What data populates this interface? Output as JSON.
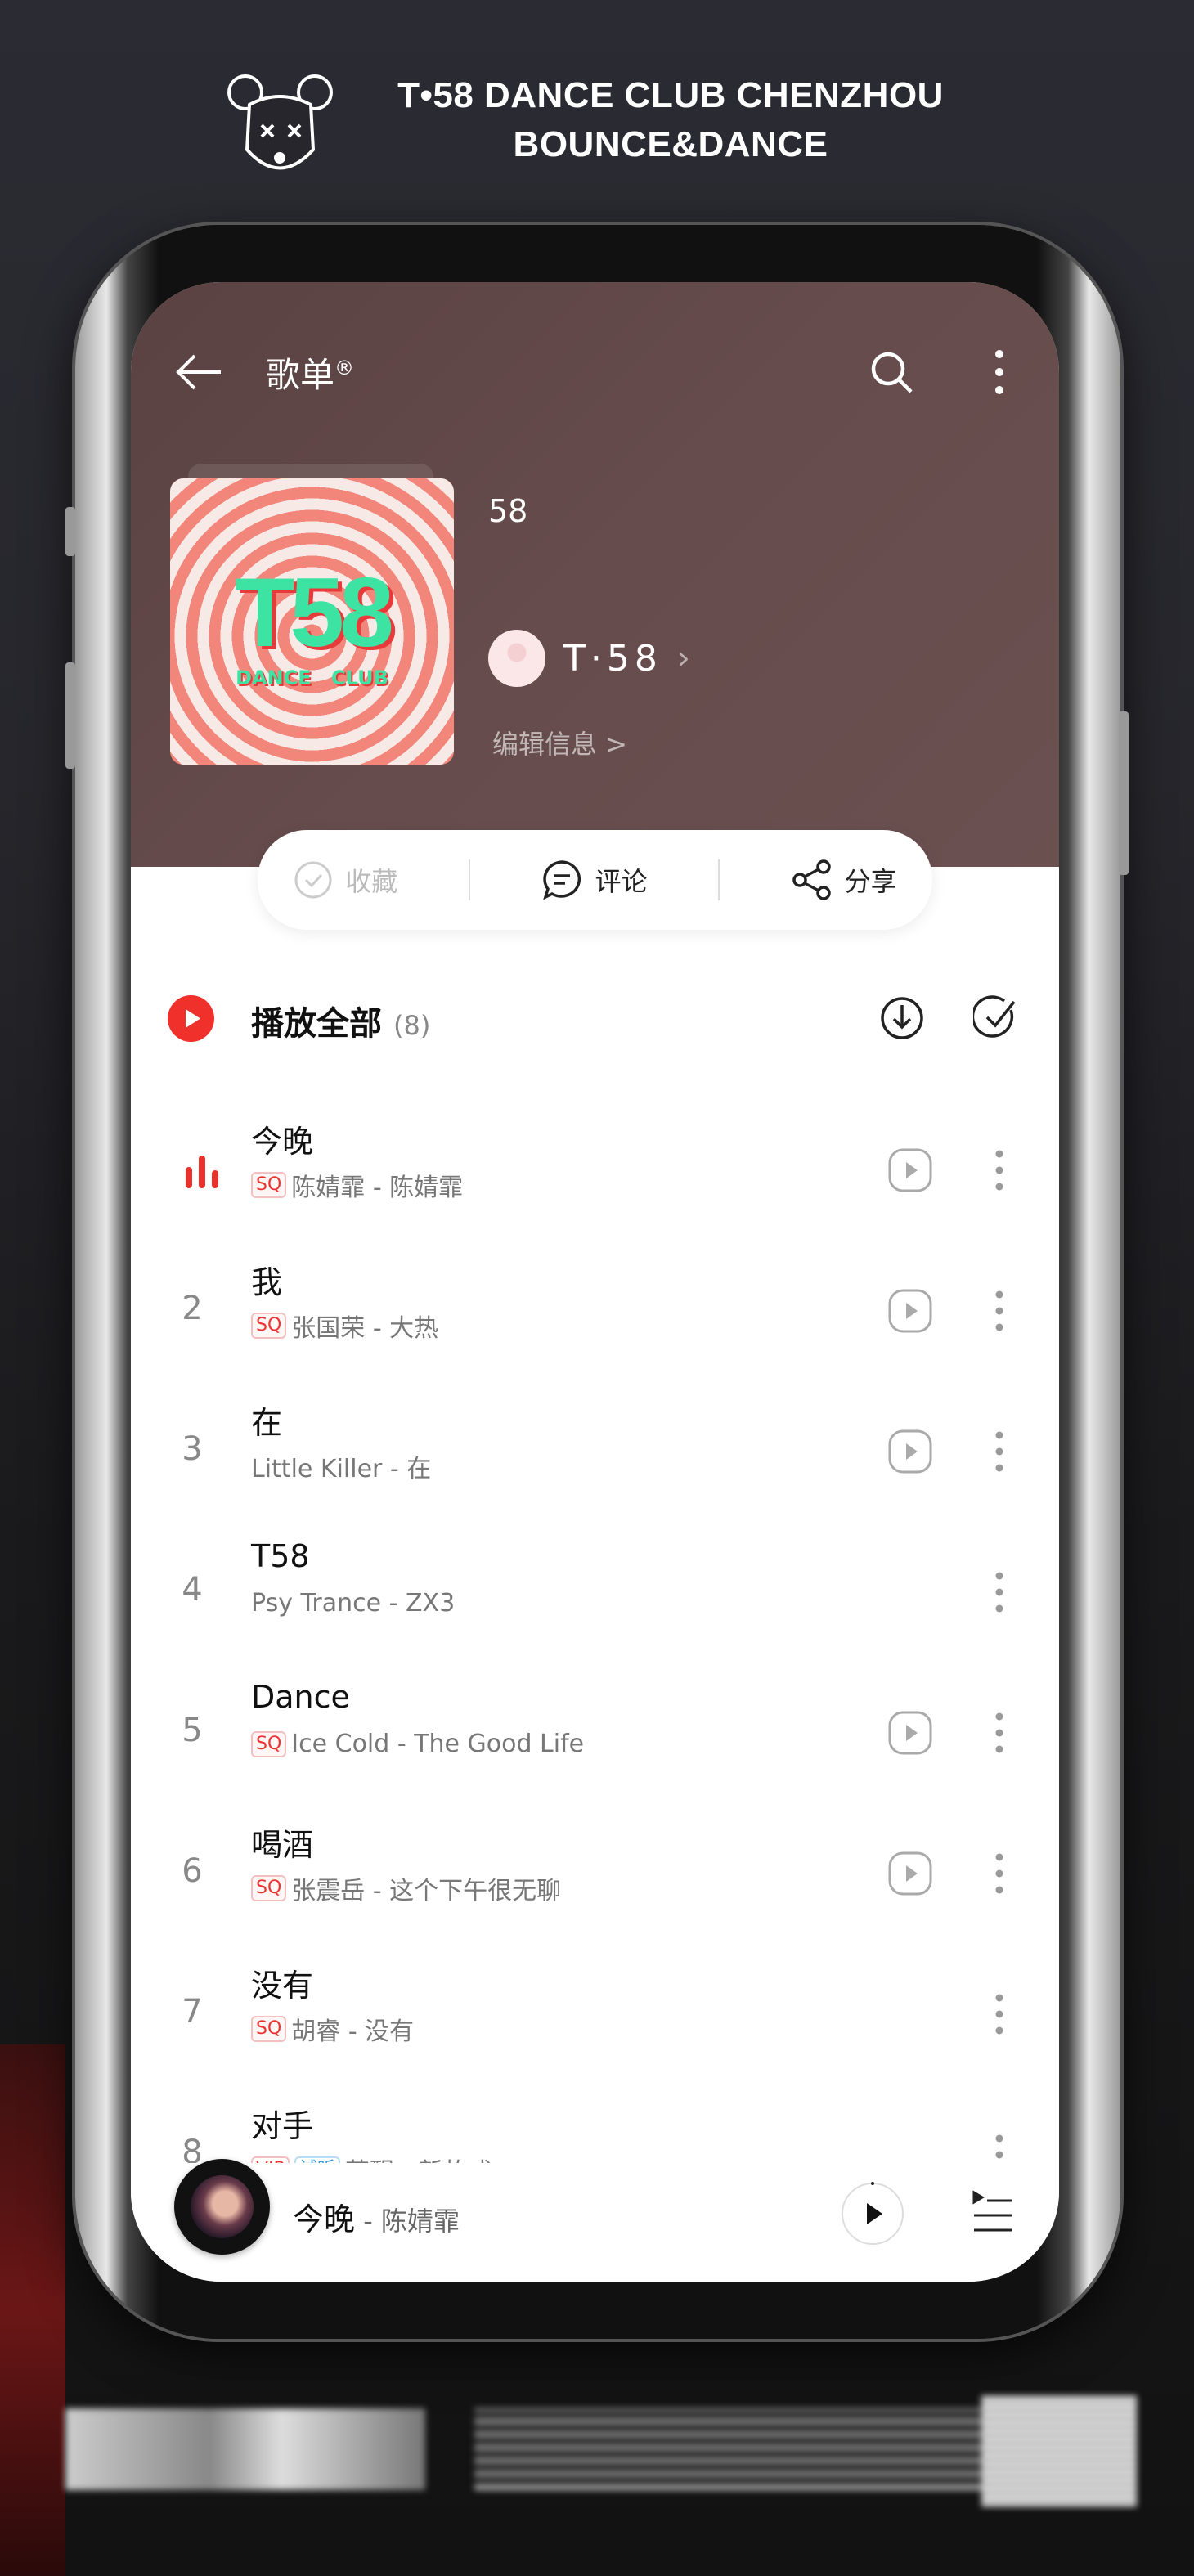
{
  "brand": {
    "line1": "T•58 DANCE CLUB CHENZHOU",
    "line2": "BOUNCE&DANCE",
    "logo_icon": "bear-head-logo"
  },
  "nav": {
    "title": "歌单",
    "title_mark": "®",
    "back_icon": "arrow-left-icon",
    "search_icon": "search-icon",
    "more_icon": "more-vertical-icon"
  },
  "playlist": {
    "cover_text": "T58",
    "cover_subtext": "DANCE CLUB",
    "title": "58",
    "creator": "T·58",
    "edit_label": "编辑信息 >"
  },
  "actions": {
    "collect": "收藏",
    "comment": "评论",
    "share": "分享"
  },
  "play_all": {
    "label": "播放全部",
    "count": "(8)"
  },
  "songs": [
    {
      "num": "1",
      "playing": true,
      "title": "今晚",
      "badges": [
        "SQ"
      ],
      "sub": "陈婧霏 - 陈婧霏",
      "mv": true
    },
    {
      "num": "2",
      "title": "我",
      "badges": [
        "SQ"
      ],
      "sub": "张国荣 - 大热",
      "mv": true
    },
    {
      "num": "3",
      "title": "在",
      "badges": [],
      "sub": "Little Killer - 在",
      "mv": true
    },
    {
      "num": "4",
      "title": "T58",
      "badges": [],
      "sub": "Psy Trance - ZX3",
      "mv": false
    },
    {
      "num": "5",
      "title": "Dance",
      "badges": [
        "SQ"
      ],
      "sub": "Ice Cold - The Good Life",
      "mv": true
    },
    {
      "num": "6",
      "title": "喝酒",
      "badges": [
        "SQ"
      ],
      "sub": "张震岳 - 这个下午很无聊",
      "mv": true
    },
    {
      "num": "7",
      "title": "没有",
      "badges": [
        "SQ"
      ],
      "sub": "胡睿 - 没有",
      "mv": false
    },
    {
      "num": "8",
      "title": "对手",
      "badges": [
        "VIP",
        "试听"
      ],
      "sub": "苏醒 - 新故式",
      "mv": false
    }
  ],
  "mini_player": {
    "title": "今晚",
    "artist": " - 陈婧霏"
  },
  "colors": {
    "accent": "#f0302a",
    "header_bg": "#5e4646",
    "cover_green": "#3de3a3",
    "cover_pink": "#f2867a"
  }
}
